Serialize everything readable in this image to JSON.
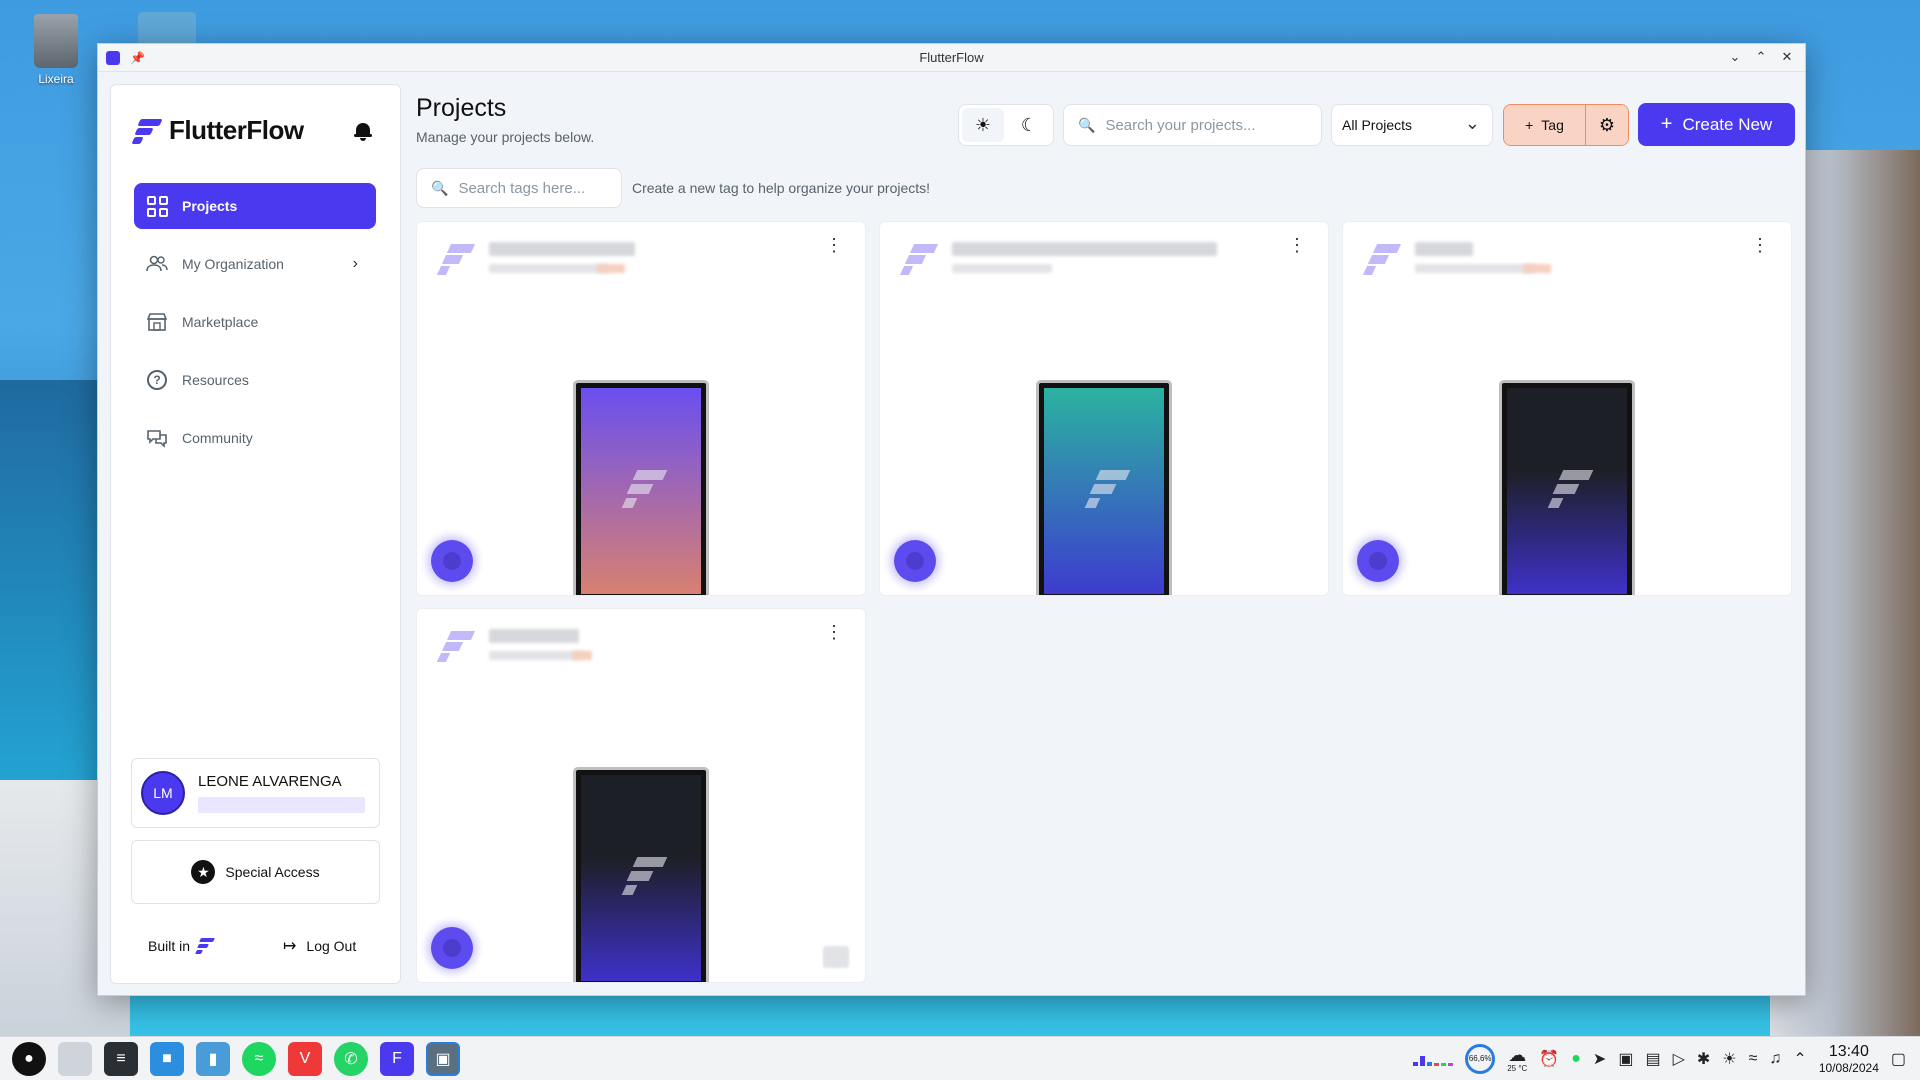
{
  "desktop": {
    "trash_label": "Lixeira"
  },
  "window": {
    "title": "FlutterFlow",
    "controls": [
      "minimize",
      "maximize",
      "close"
    ]
  },
  "sidebar": {
    "brand": "FlutterFlow",
    "items": [
      {
        "label": "Projects",
        "icon": "grid-icon",
        "active": true
      },
      {
        "label": "My Organization",
        "icon": "users-icon",
        "has_chevron": true
      },
      {
        "label": "Marketplace",
        "icon": "store-icon"
      },
      {
        "label": "Resources",
        "icon": "help-circle-icon"
      },
      {
        "label": "Community",
        "icon": "chat-icon"
      }
    ],
    "user": {
      "initials": "LM",
      "name": "LEONE ALVARENGA"
    },
    "special_access_label": "Special Access",
    "built_in_label": "Built in",
    "logout_label": "Log Out"
  },
  "main": {
    "title": "Projects",
    "subtitle": "Manage your projects below.",
    "search_placeholder": "Search your projects...",
    "filter_value": "All Projects",
    "tag_button_label": "Tag",
    "create_button_label": "Create New",
    "tag_search_placeholder": "Search tags here...",
    "tag_hint": "Create a new tag to help organize your projects!",
    "cards": [
      {
        "phone_gradient": [
          "#6a4ff0",
          "#d88070"
        ],
        "name_redacted": true
      },
      {
        "phone_gradient": [
          "#2bb3a0",
          "#3d3ccf"
        ],
        "name_redacted": true
      },
      {
        "phone_gradient": [
          "#1d1f26",
          "#3e31c9"
        ],
        "name_redacted": true
      },
      {
        "phone_gradient": [
          "#1d1f26",
          "#3e31c9"
        ],
        "name_redacted": true
      }
    ]
  },
  "taskbar": {
    "cpu_percent": "66,6%",
    "temperature": "25 °C",
    "time": "13:40",
    "date": "10/08/2024"
  },
  "colors": {
    "accent": "#4b39ef",
    "tag_bg": "#f9d4c4",
    "tag_border": "#ee8b60",
    "page_bg": "#f1f4f8"
  }
}
